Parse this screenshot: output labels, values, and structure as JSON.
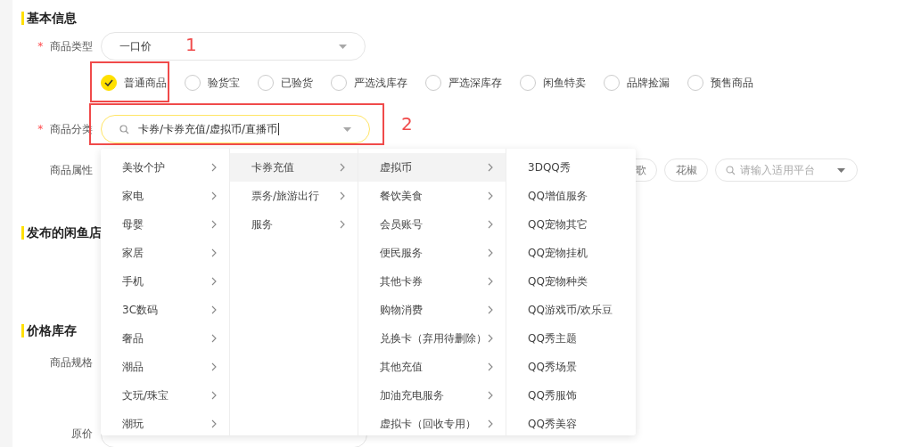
{
  "sections": [
    {
      "title": "基本信息"
    },
    {
      "title": "发布的闲鱼店"
    },
    {
      "title": "价格库存"
    }
  ],
  "product_type": {
    "label": "商品类型",
    "required_mark": "*",
    "value": "一口价"
  },
  "product_kinds": [
    {
      "label": "普通商品",
      "selected": true
    },
    {
      "label": "验货宝",
      "selected": false
    },
    {
      "label": "已验货",
      "selected": false
    },
    {
      "label": "严选浅库存",
      "selected": false
    },
    {
      "label": "严选深库存",
      "selected": false
    },
    {
      "label": "闲鱼特卖",
      "selected": false
    },
    {
      "label": "品牌捡漏",
      "selected": false
    },
    {
      "label": "预售商品",
      "selected": false
    }
  ],
  "category": {
    "label": "商品分类",
    "required_mark": "*",
    "value": "卡券/卡券充值/虚拟币/直播币"
  },
  "attributes": {
    "label": "商品属性",
    "tags": [
      "歌",
      "花椒"
    ],
    "platform_placeholder": "请输入适用平台"
  },
  "spec": {
    "label": "商品规格"
  },
  "price": {
    "label": "原价"
  },
  "cascader": [
    {
      "items": [
        {
          "label": "美妆个护",
          "selected": false
        },
        {
          "label": "家电",
          "selected": false
        },
        {
          "label": "母婴",
          "selected": false
        },
        {
          "label": "家居",
          "selected": false
        },
        {
          "label": "手机",
          "selected": false
        },
        {
          "label": "3C数码",
          "selected": false
        },
        {
          "label": "奢品",
          "selected": false
        },
        {
          "label": "潮品",
          "selected": false
        },
        {
          "label": "文玩/珠宝",
          "selected": false
        },
        {
          "label": "潮玩",
          "selected": false
        }
      ]
    },
    {
      "items": [
        {
          "label": "卡券充值",
          "selected": true
        },
        {
          "label": "票务/旅游出行",
          "selected": false
        },
        {
          "label": "服务",
          "selected": false
        }
      ]
    },
    {
      "items": [
        {
          "label": "虚拟币",
          "selected": true
        },
        {
          "label": "餐饮美食",
          "selected": false
        },
        {
          "label": "会员账号",
          "selected": false
        },
        {
          "label": "便民服务",
          "selected": false
        },
        {
          "label": "其他卡券",
          "selected": false
        },
        {
          "label": "购物消费",
          "selected": false
        },
        {
          "label": "兑换卡（弃用待删除）",
          "selected": false
        },
        {
          "label": "其他充值",
          "selected": false
        },
        {
          "label": "加油充电服务",
          "selected": false
        },
        {
          "label": "虚拟卡（回收专用）",
          "selected": false
        }
      ]
    },
    {
      "items": [
        {
          "label": "3DQQ秀",
          "selected": false,
          "leaf": true
        },
        {
          "label": "QQ增值服务",
          "selected": false,
          "leaf": true
        },
        {
          "label": "QQ宠物其它",
          "selected": false,
          "leaf": true
        },
        {
          "label": "QQ宠物挂机",
          "selected": false,
          "leaf": true
        },
        {
          "label": "QQ宠物种类",
          "selected": false,
          "leaf": true
        },
        {
          "label": "QQ游戏币/欢乐豆",
          "selected": false,
          "leaf": true
        },
        {
          "label": "QQ秀主题",
          "selected": false,
          "leaf": true
        },
        {
          "label": "QQ秀场景",
          "selected": false,
          "leaf": true
        },
        {
          "label": "QQ秀服饰",
          "selected": false,
          "leaf": true
        },
        {
          "label": "QQ秀美容",
          "selected": false,
          "leaf": true
        }
      ]
    }
  ],
  "annotations": [
    {
      "number": "1"
    },
    {
      "number": "2"
    }
  ]
}
